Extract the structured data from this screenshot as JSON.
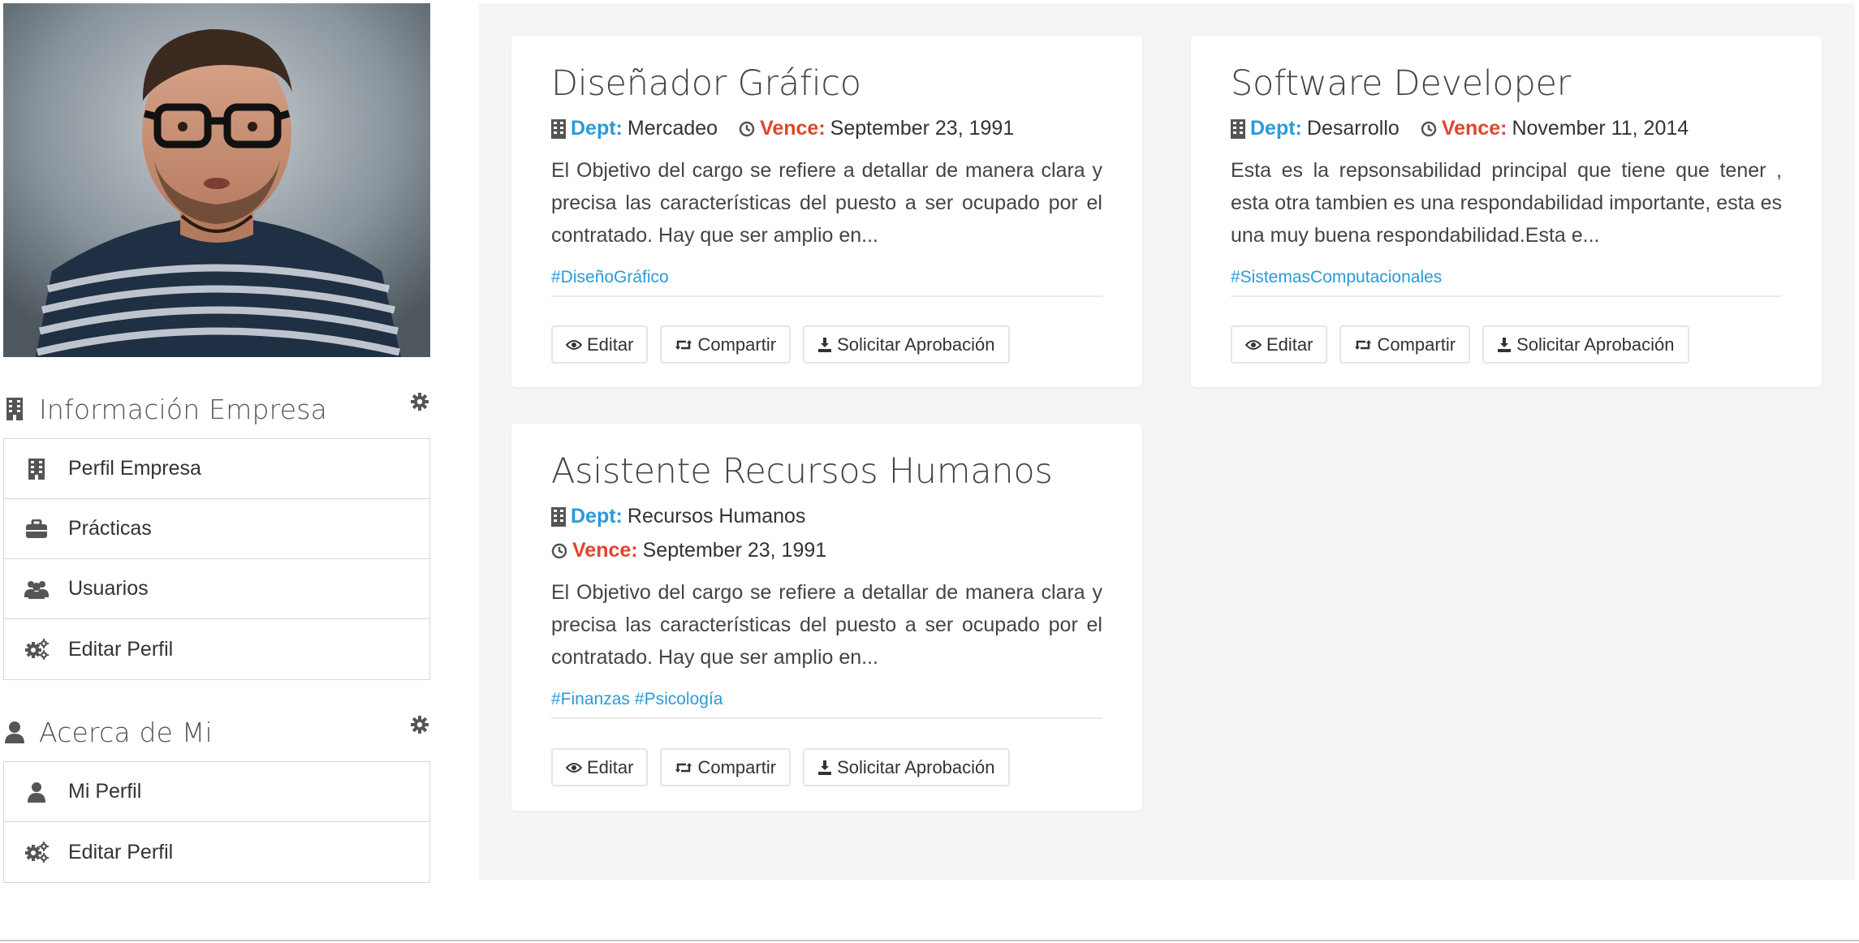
{
  "sidebar": {
    "company_section": {
      "title": "Información Empresa",
      "items": [
        {
          "label": "Perfil Empresa",
          "icon": "building-icon"
        },
        {
          "label": "Prácticas",
          "icon": "briefcase-icon"
        },
        {
          "label": "Usuarios",
          "icon": "users-icon"
        },
        {
          "label": "Editar Perfil",
          "icon": "cogs-icon"
        }
      ]
    },
    "about_section": {
      "title": "Acerca de Mi",
      "items": [
        {
          "label": "Mi Perfil",
          "icon": "user-icon"
        },
        {
          "label": "Editar Perfil",
          "icon": "cogs-icon"
        }
      ]
    }
  },
  "labels": {
    "dept": "Dept:",
    "due": "Vence:",
    "edit": "Editar",
    "share": "Compartir",
    "request": "Solicitar Aprobación"
  },
  "cards": [
    {
      "title": "Diseñador Gráfico",
      "dept": "Mercadeo",
      "due": "September 23, 1991",
      "description": "El Objetivo del cargo se refiere a detallar de manera clara y precisa las características del puesto a ser ocupado por el contratado. Hay que ser amplio en...",
      "tags": [
        "#DiseñoGráfico"
      ]
    },
    {
      "title": "Software Developer",
      "dept": "Desarrollo",
      "due": "November 11, 2014",
      "description": "Esta es la repsonsabilidad principal que tiene que tener , esta otra tambien es una respondabilidad importante, esta es una muy buena respondabilidad.Esta e...",
      "tags": [
        "#SistemasComputacionales"
      ]
    },
    {
      "title": "Asistente Recursos Humanos",
      "dept": "Recursos Humanos",
      "due": "September 23, 1991",
      "description": "El Objetivo del cargo se refiere a detallar de manera clara y precisa las características del puesto a ser ocupado por el contratado. Hay que ser amplio en...",
      "tags": [
        "#Finanzas",
        "#Psicología"
      ]
    }
  ],
  "colors": {
    "accent_blue": "#2a9ad9",
    "due_red": "#e0452e",
    "content_bg": "#f5f5f5"
  }
}
